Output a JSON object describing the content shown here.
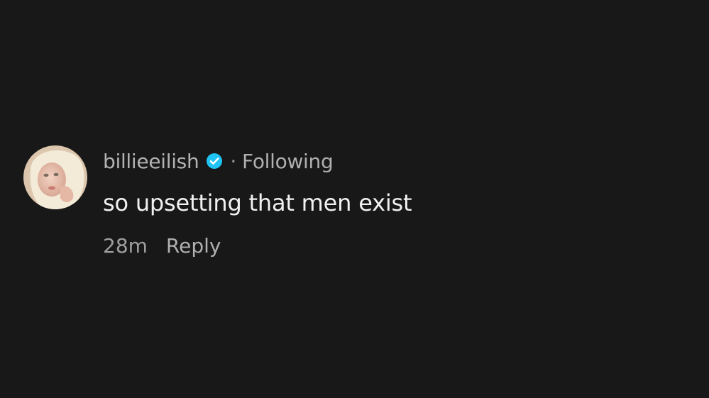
{
  "comment": {
    "username": "billieeilish",
    "verified_icon": "verified-check-icon",
    "separator": "·",
    "follow_status": "Following",
    "text": "so upsetting that men exist",
    "timestamp": "28m",
    "reply_label": "Reply"
  },
  "colors": {
    "background": "#181818",
    "verified": "#20C4F4",
    "text_primary": "#F1F1F1",
    "text_secondary": "#A9A9A9"
  }
}
